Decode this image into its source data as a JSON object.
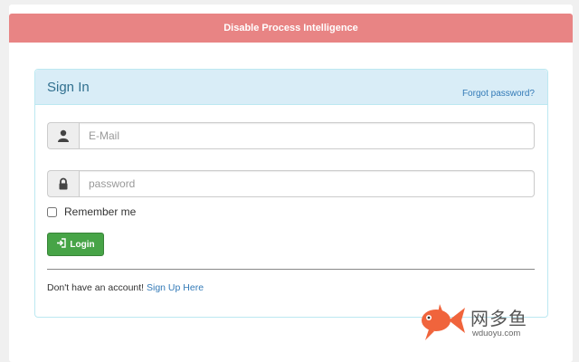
{
  "banner": {
    "text": "Disable Process Intelligence"
  },
  "panel": {
    "title": "Sign In",
    "forgot_password": "Forgot password?"
  },
  "email": {
    "placeholder": "E-Mail",
    "icon": "user-icon"
  },
  "password": {
    "placeholder": "password",
    "icon": "lock-icon"
  },
  "remember": {
    "label": "Remember me",
    "checked": false
  },
  "login": {
    "label": "Login",
    "icon": "sign-in-icon"
  },
  "signup": {
    "prompt": "Don't have an account!",
    "link": "Sign Up Here"
  },
  "watermark": {
    "name": "网多鱼",
    "url": "wduoyu.com"
  },
  "colors": {
    "banner": "#e88484",
    "panel_heading": "#d9edf7",
    "panel_border": "#bce8f1",
    "title_text": "#31708f",
    "link": "#337ab7",
    "login_button": "#47a447",
    "fish_logo": "#f0643c"
  }
}
